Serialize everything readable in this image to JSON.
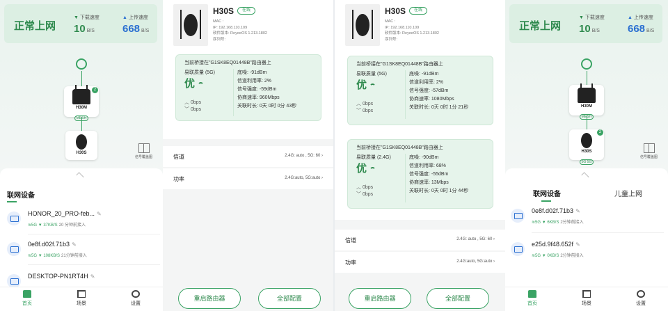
{
  "home": {
    "status": "正常上网",
    "download_label": "下载速度",
    "upload_label": "上传速度",
    "download_value": "10",
    "upload_value": "668",
    "unit": "B/S",
    "upload_value_right": "668",
    "heatmap_label": "信号覆盖图",
    "primary_router": {
      "name": "H30M",
      "tag": "MESH",
      "badge": "2"
    },
    "secondary_router": {
      "name": "H30S"
    },
    "secondary_router_right": {
      "name": "H30S",
      "sub": "5G 5G",
      "badge": "2"
    },
    "sheet_title": "联网设备",
    "sheet_tab2": "儿童上网",
    "devices_left": [
      {
        "name": "HONOR_20_PRO-feb...",
        "band": "5G",
        "speed": "37KB/S",
        "time": "20 分钟前接入"
      },
      {
        "name": "0e8f.d02f.71b3",
        "band": "5G",
        "speed": "108KB/S",
        "time": "21分钟前接入"
      },
      {
        "name": "DESKTOP-PN1RT4H"
      }
    ],
    "devices_right": [
      {
        "name": "0e8f.d02f.71b3",
        "band": "5G",
        "speed": "6KB/S",
        "time": "2分钟前接入"
      },
      {
        "name": "e25d.9f48.652f",
        "band": "5G",
        "speed": "0KB/S",
        "time": "2分钟前接入"
      }
    ],
    "tabs": [
      "首页",
      "场景",
      "设置"
    ]
  },
  "detail_left": {
    "title": "H30S",
    "online": "在线",
    "info": [
      "MAC :",
      "IP: 192.168.110.109",
      "软件版本: ReyeeOS 1.213.1802",
      "序列号:"
    ],
    "bridge": {
      "head": "当前桥接在\"G1SK8EQ01448B\"路由器上",
      "quality_label": "易联质量 (5G)",
      "quality": "优",
      "rate_up": "0bps",
      "rate_down": "0bps",
      "stats": [
        "底噪: -91dBm",
        "信道利用率: 2%",
        "信号强度: -59dBm",
        "协商速率: 960Mbps",
        "关联时长: 0天 0时 0分 43秒"
      ]
    },
    "rows": [
      {
        "k": "信道",
        "v": "2.4G: auto , 5G: 60"
      },
      {
        "k": "功率",
        "v": "2.4G:auto, 5G:auto"
      }
    ],
    "btn_restart": "重启路由器",
    "btn_config": "全部配置"
  },
  "detail_right": {
    "title": "H30S",
    "online": "在线",
    "info": [
      "MAC :",
      "IP: 192.168.110.109",
      "软件版本: ReyeeOS 1.213.1802",
      "序列号:"
    ],
    "bridge1": {
      "head": "当前桥接在\"G1SK8EQ01448B\"路由器上",
      "quality_label": "易联质量 (5G)",
      "quality": "优",
      "rate_up": "0bps",
      "rate_down": "0bps",
      "stats": [
        "底噪: -91dBm",
        "信道利用率: 2%",
        "信号强度: -57dBm",
        "协商速率: 1080Mbps",
        "关联时长: 0天 0时 1分 21秒"
      ]
    },
    "bridge2": {
      "head": "当前桥接在\"G1SK8EQ01448B\"路由器上",
      "quality_label": "易联质量 (2.4G)",
      "quality": "优",
      "rate_up": "0bps",
      "rate_down": "0bps",
      "stats": [
        "底噪: -90dBm",
        "信道利用率: 68%",
        "信号强度: -55dBm",
        "协商速率: 13Mbps",
        "关联时长: 0天 0时 1分 44秒"
      ]
    },
    "rows": [
      {
        "k": "信道",
        "v": "2.4G: auto , 5G: 60"
      },
      {
        "k": "功率",
        "v": "2.4G:auto, 5G:auto"
      }
    ],
    "btn_restart": "重启路由器",
    "btn_config": "全部配置"
  },
  "colors": {
    "accent": "#3aa364",
    "upload": "#2a6fd1",
    "card_bg": "#dcefe3",
    "bridge_bg": "#e6f4eb"
  }
}
